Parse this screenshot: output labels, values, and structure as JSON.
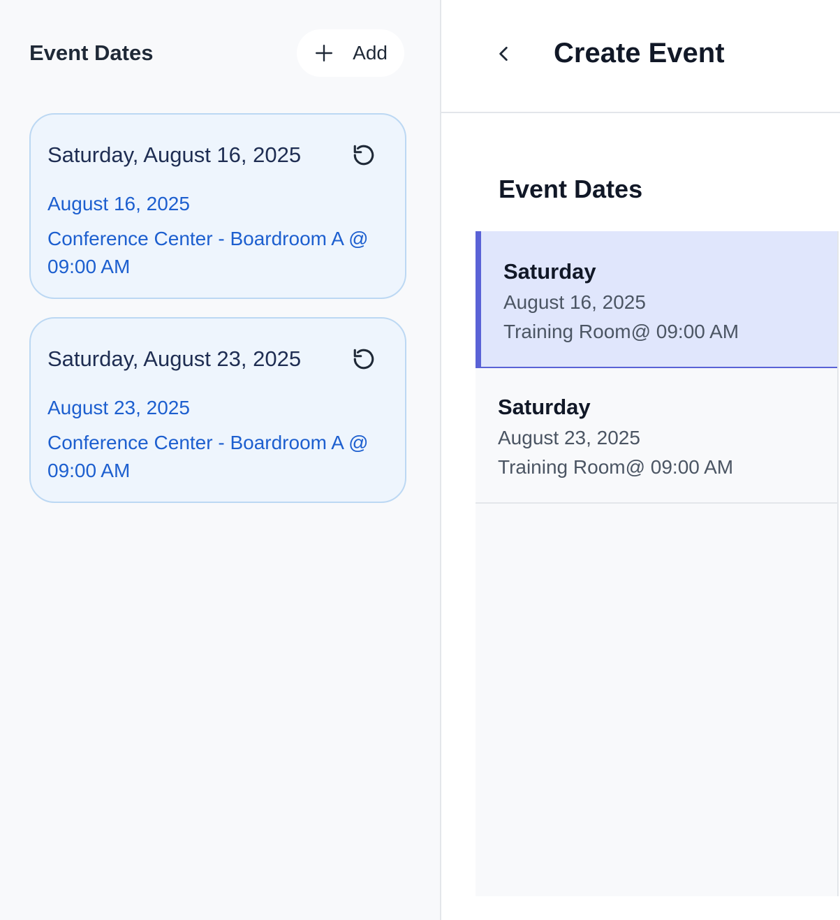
{
  "left_panel": {
    "title": "Event Dates",
    "add_label": "Add",
    "cards": [
      {
        "title": "Saturday, August 16, 2025",
        "date": "August 16, 2025",
        "location": "Conference Center - Boardroom A @ 09:00 AM"
      },
      {
        "title": "Saturday, August 23, 2025",
        "date": "August 23, 2025",
        "location": "Conference Center - Boardroom A @ 09:00 AM"
      }
    ]
  },
  "right_panel": {
    "page_title": "Create Event",
    "section_title": "Event Dates",
    "items": [
      {
        "day": "Saturday",
        "date": "August 16, 2025",
        "location": "Training Room@ 09:00 AM",
        "selected": true
      },
      {
        "day": "Saturday",
        "date": "August 23, 2025",
        "location": "Training Room@ 09:00 AM",
        "selected": false
      }
    ]
  },
  "icons": {
    "add": "plus-icon",
    "reset": "reset-icon",
    "back": "chevron-left-icon"
  },
  "colors": {
    "card_background": "#eef5fd",
    "card_border": "#bcd8f3",
    "card_link_text": "#1d5fcf",
    "selected_item_background": "#e0e6fc",
    "selected_item_accent": "#5a62d6"
  }
}
